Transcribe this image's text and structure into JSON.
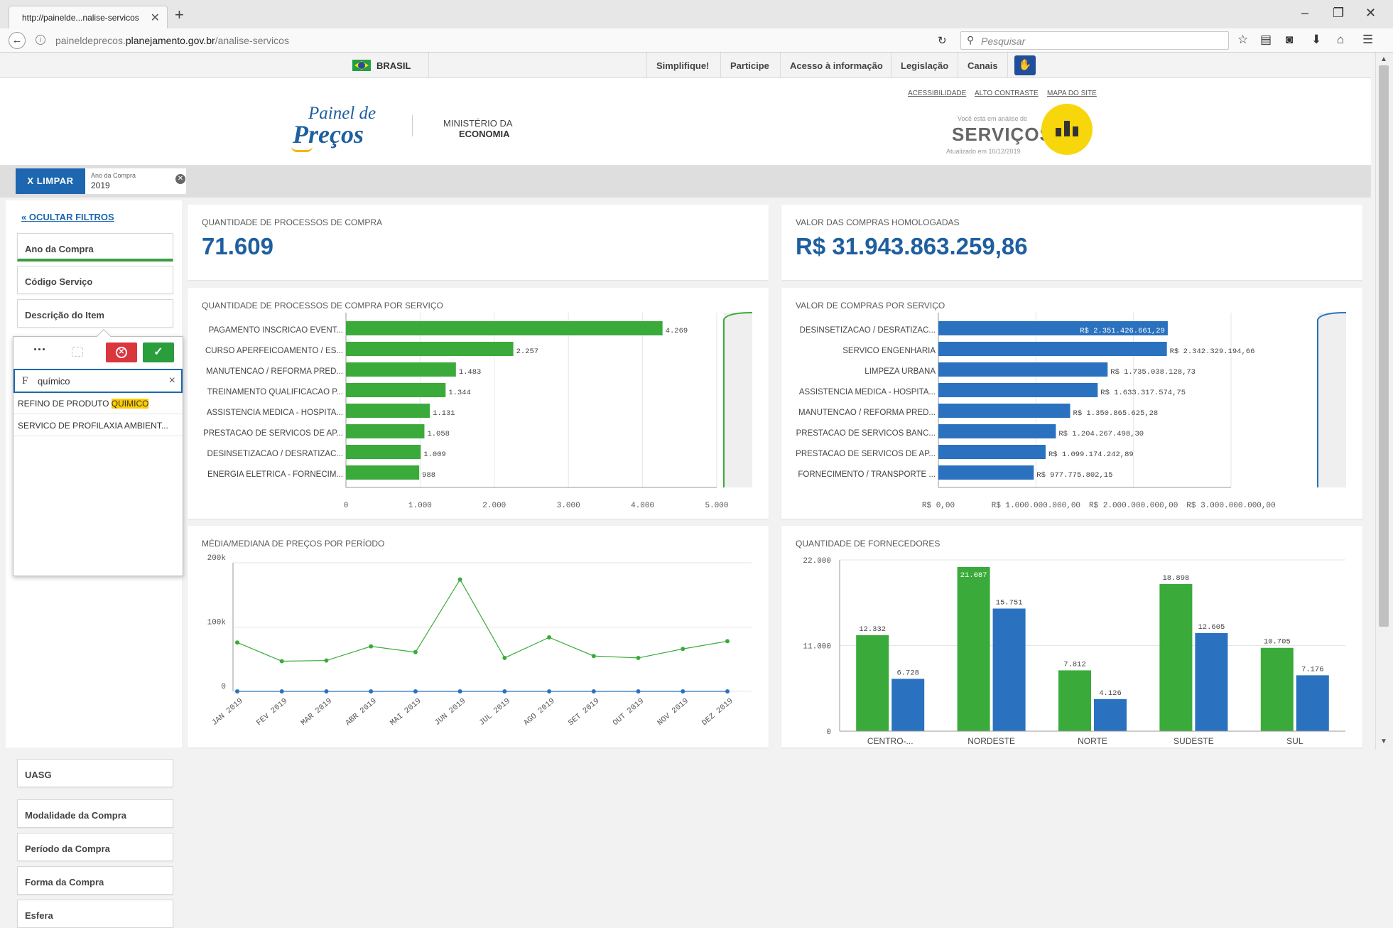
{
  "browser": {
    "tab_title": "http://painelde...nalise-servicos",
    "url_prefix": "paineldeprecos.",
    "url_domain": "planejamento.gov.br",
    "url_path": "/analise-servicos",
    "search_placeholder": "Pesquisar"
  },
  "gov_bar": {
    "country": "BRASIL",
    "links": [
      "Simplifique!",
      "Participe",
      "Acesso à informação",
      "Legislação",
      "Canais"
    ]
  },
  "header": {
    "logo_small": "Painel de",
    "logo_big": "Preços",
    "ministry_line1": "MINISTÉRIO DA",
    "ministry_line2": "ECONOMIA",
    "access_links": [
      "ACESSIBILIDADE",
      "ALTO CONTRASTE",
      "MAPA DO SITE"
    ],
    "analysis_prefix": "Você está em análise de",
    "analysis_title": "SERVIÇOS",
    "updated": "Atualizado em 10/12/2019"
  },
  "selections": {
    "clear_label": "X LIMPAR",
    "chip_field": "Ano da Compra",
    "chip_value": "2019"
  },
  "filters": {
    "hide_label": "OCULTAR FILTROS",
    "items": [
      "Ano da Compra",
      "Código Serviço",
      "Descrição do Item",
      "UASG",
      "Modalidade da Compra",
      "Período da Compra",
      "Forma da Compra",
      "Esfera"
    ]
  },
  "popover": {
    "more": "···",
    "search_icon": "F",
    "search_value": "químico",
    "clear": "×",
    "results": [
      {
        "before": "REFINO DE PRODUTO ",
        "highlight": "QUIMICO",
        "after": ""
      },
      {
        "before": "SERVICO DE PROFILAXIA AMBIENT...",
        "highlight": "",
        "after": ""
      }
    ]
  },
  "kpis": {
    "processos_title": "QUANTIDADE DE PROCESSOS DE COMPRA",
    "processos_value": "71.609",
    "valor_title": "VALOR DAS COMPRAS HOMOLOGADAS",
    "valor_value": "R$ 31.943.863.259,86"
  },
  "colors": {
    "green": "#3aab3a",
    "blue": "#2a72bf",
    "brand_blue": "#1f5f9f",
    "yellow": "#f7d70c"
  },
  "chart_data": [
    {
      "type": "bar",
      "orientation": "horizontal",
      "title": "QUANTIDADE DE PROCESSOS DE COMPRA POR SERVIÇO",
      "categories": [
        "PAGAMENTO INSCRICAO EVENT...",
        "CURSO APERFEICOAMENTO / ES...",
        "MANUTENCAO / REFORMA PRED...",
        "TREINAMENTO QUALIFICACAO P...",
        "ASSISTENCIA MEDICA - HOSPITA...",
        "PRESTACAO DE SERVICOS DE AP...",
        "DESINSETIZACAO / DESRATIZAC...",
        "ENERGIA ELETRICA - FORNECIM..."
      ],
      "values": [
        4269,
        2257,
        1483,
        1344,
        1131,
        1058,
        1009,
        988
      ],
      "labels": [
        "4.269",
        "2.257",
        "1.483",
        "1.344",
        "1.131",
        "1.058",
        "1.009",
        "988"
      ],
      "xlim": [
        0,
        5000
      ],
      "ticks": [
        "0",
        "1.000",
        "2.000",
        "3.000",
        "4.000",
        "5.000"
      ],
      "color": "#3aab3a"
    },
    {
      "type": "bar",
      "orientation": "horizontal",
      "title": "VALOR DE COMPRAS POR SERVIÇO",
      "categories": [
        "DESINSETIZACAO / DESRATIZAC...",
        "SERVICO ENGENHARIA",
        "LIMPEZA URBANA",
        "ASSISTENCIA MEDICA - HOSPITA...",
        "MANUTENCAO / REFORMA PRED...",
        "PRESTACAO DE SERVICOS BANC...",
        "PRESTACAO DE SERVICOS DE AP...",
        "FORNECIMENTO / TRANSPORTE ..."
      ],
      "values": [
        2351426661.29,
        2342329194.66,
        1735038128.73,
        1633317574.75,
        1350865625.28,
        1204267498.3,
        1099174242.89,
        977775802.15
      ],
      "labels": [
        "R$ 2.351.426.661,29",
        "R$ 2.342.329.194,66",
        "R$ 1.735.038.128,73",
        "R$ 1.633.317.574,75",
        "R$ 1.350.865.625,28",
        "R$ 1.204.267.498,30",
        "R$ 1.099.174.242,89",
        "R$ 977.775.802,15"
      ],
      "xlim": [
        0,
        3000000000
      ],
      "ticks": [
        "R$ 0,00",
        "R$ 1.000.000.000,00",
        "R$ 2.000.000.000,00",
        "R$ 3.000.000.000,00"
      ],
      "color": "#2a72bf"
    },
    {
      "type": "line",
      "title": "MÉDIA/MEDIANA DE PREÇOS POR PERÍODO",
      "x": [
        "JAN 2019",
        "FEV 2019",
        "MAR 2019",
        "ABR 2019",
        "MAI 2019",
        "JUN 2019",
        "JUL 2019",
        "AGO 2019",
        "SET 2019",
        "OUT 2019",
        "NOV 2019",
        "DEZ 2019"
      ],
      "series": [
        {
          "color": "#3aab3a",
          "values": [
            76000,
            47000,
            48000,
            70000,
            61000,
            174000,
            52000,
            84000,
            55000,
            52000,
            66000,
            78000
          ]
        },
        {
          "color": "#2a72bf",
          "values": [
            0,
            0,
            0,
            0,
            0,
            0,
            0,
            0,
            0,
            0,
            0,
            0
          ]
        }
      ],
      "ylim": [
        0,
        200000
      ],
      "yticks": [
        "0",
        "100k",
        "200k"
      ]
    },
    {
      "type": "bar",
      "title": "QUANTIDADE DE FORNECEDORES",
      "categories": [
        "CENTRO-...",
        "NORDESTE",
        "NORTE",
        "SUDESTE",
        "SUL"
      ],
      "series": [
        {
          "color": "#3aab3a",
          "values": [
            12332,
            21087,
            7812,
            18898,
            10705
          ],
          "labels": [
            "12.332",
            "21.087",
            "7.812",
            "18.898",
            "10.705"
          ]
        },
        {
          "color": "#2a72bf",
          "values": [
            6728,
            15751,
            4126,
            12605,
            7176
          ],
          "labels": [
            "6.728",
            "15.751",
            "4.126",
            "12.605",
            "7.176"
          ]
        }
      ],
      "ylim": [
        0,
        22000
      ],
      "yticks": [
        "0",
        "11.000",
        "22.000"
      ]
    }
  ]
}
